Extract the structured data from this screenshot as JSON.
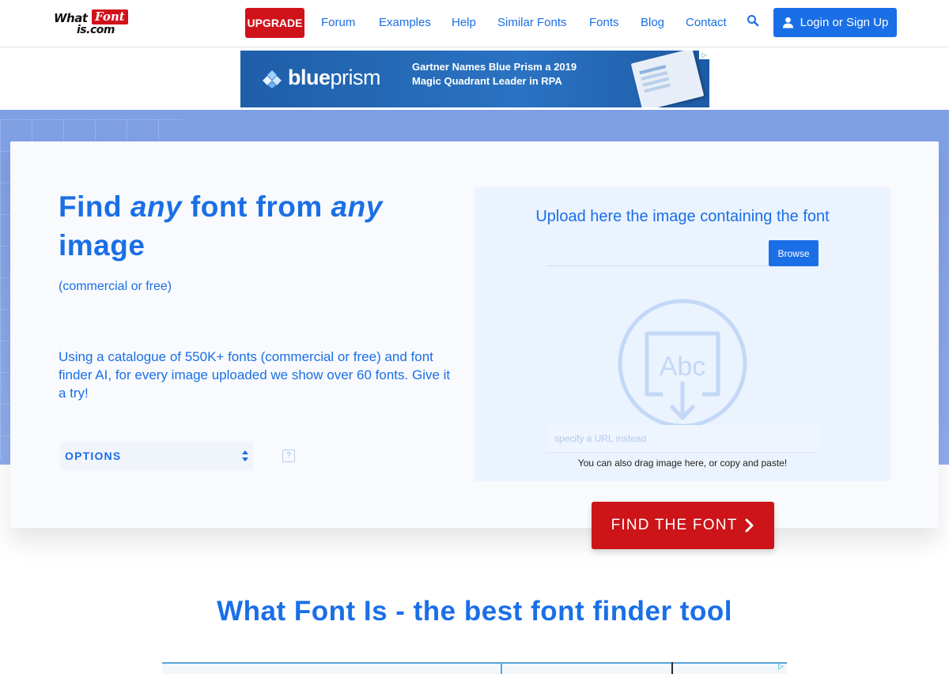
{
  "header": {
    "logo": {
      "part1": "What",
      "part2": "Font",
      "part3": "is.com"
    },
    "upgrade_label": "UPGRADE",
    "nav": [
      {
        "label": "Forum"
      },
      {
        "label": "Examples"
      },
      {
        "label": "Help"
      },
      {
        "label": "Similar Fonts"
      },
      {
        "label": "Fonts"
      },
      {
        "label": "Blog"
      },
      {
        "label": "Contact"
      }
    ],
    "search_icon": "search-icon",
    "login_label": "Login or Sign Up",
    "login_icon": "user-icon"
  },
  "ad": {
    "brand_prefix": "blue",
    "brand_suffix": "prism",
    "line1": "Gartner Names Blue Prism a 2019",
    "line2": "Magic Quadrant Leader in RPA"
  },
  "hero": {
    "headline_1": "Find ",
    "headline_2": "any",
    "headline_3": " font from ",
    "headline_4": "any",
    "headline_5": " image",
    "subhead": "(commercial or free)",
    "description": "Using a catalogue of 550K+ fonts (commercial or free) and font finder AI, for every image uploaded we show over 60 fonts. Give it a try!",
    "options_label": "OPTIONS",
    "help_label": "?"
  },
  "upload": {
    "title": "Upload here the image containing the font",
    "browse_label": "Browse",
    "graphic_text": "Abc",
    "url_placeholder": "specify a URL instead",
    "drag_hint": "You can also drag image here, or copy and paste!"
  },
  "find_label": "FIND THE FONT",
  "bottom_title": "What Font Is - the best font finder tool",
  "colors": {
    "brand_blue": "#1a6fe6",
    "brand_red": "#cc1419",
    "hero_band": "#8eadec",
    "panel": "#ebf3fe"
  }
}
